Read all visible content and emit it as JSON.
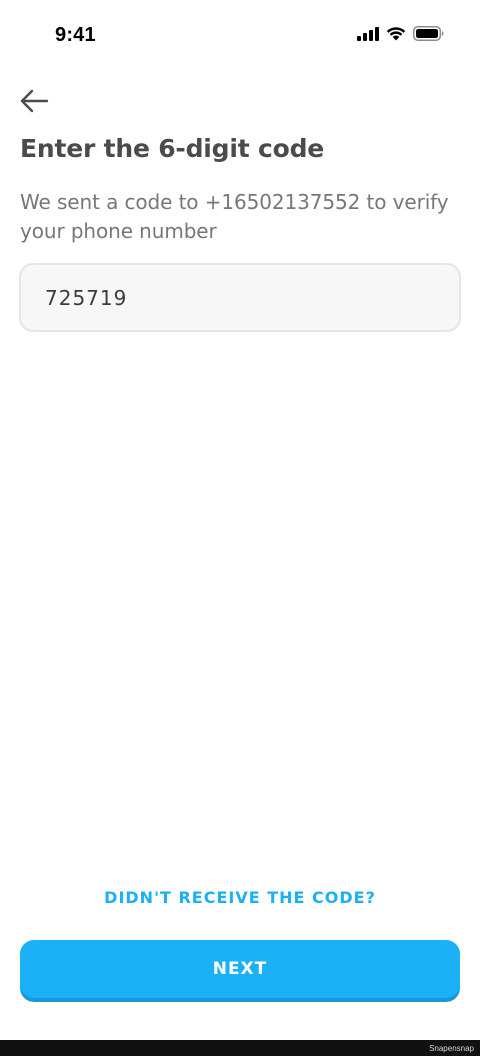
{
  "status_bar": {
    "time": "9:41",
    "icons": [
      "signal-icon",
      "wifi-icon",
      "battery-icon"
    ]
  },
  "header": {
    "back_icon": "arrow-left-icon",
    "title": "Enter the 6-digit code",
    "subtitle": "We sent a code to +16502137552 to verify your phone number"
  },
  "code_field": {
    "value": "725719"
  },
  "actions": {
    "resend_label": "DIDN'T RECEIVE THE CODE?",
    "next_label": "NEXT"
  },
  "watermark": "Snapensnap",
  "colors": {
    "accent": "#1cb0f6",
    "accent_shadow": "#1899d6",
    "title_text": "#4b4b4b",
    "subtitle_text": "#777777",
    "input_bg": "#f7f7f7",
    "input_border": "#e5e5e5"
  }
}
